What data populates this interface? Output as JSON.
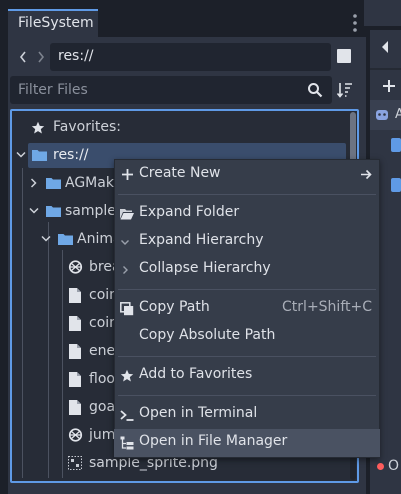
{
  "dock": {
    "tab_title": "FileSystem",
    "path_value": "res://",
    "filter_placeholder": "Filter Files"
  },
  "tree": {
    "favorites": "Favorites:",
    "root": "res://",
    "items": [
      {
        "label": "AGMake",
        "kind": "folder"
      },
      {
        "label": "sample",
        "kind": "folder"
      },
      {
        "label": "Anima",
        "kind": "folder"
      },
      {
        "label": "brea",
        "kind": "animation"
      },
      {
        "label": "coin",
        "kind": "file"
      },
      {
        "label": "coin",
        "kind": "file"
      },
      {
        "label": "ene",
        "kind": "file"
      },
      {
        "label": "floo",
        "kind": "file"
      },
      {
        "label": "goa",
        "kind": "file"
      },
      {
        "label": "jum",
        "kind": "animation"
      },
      {
        "label": "sample_sprite.png",
        "kind": "image"
      }
    ]
  },
  "context_menu": {
    "create_new": "Create New",
    "expand_folder": "Expand Folder",
    "expand_hierarchy": "Expand Hierarchy",
    "collapse_hierarchy": "Collapse Hierarchy",
    "copy_path": "Copy Path",
    "copy_path_shortcut": "Ctrl+Shift+C",
    "copy_absolute_path": "Copy Absolute Path",
    "add_to_favorites": "Add to Favorites",
    "open_in_terminal": "Open in Terminal",
    "open_in_file_manager": "Open in File Manager"
  },
  "right_dock": {
    "node_label": "A",
    "status_text": "O"
  },
  "colors": {
    "accent": "#5f9ae6",
    "panel": "#2f3543",
    "background": "#1c2029",
    "menu": "#363d4a",
    "menu_hover": "#4a5262",
    "selection": "#3a4d6c",
    "folder_icon": "#6fa8e6",
    "error_dot": "#ff5d5d"
  }
}
